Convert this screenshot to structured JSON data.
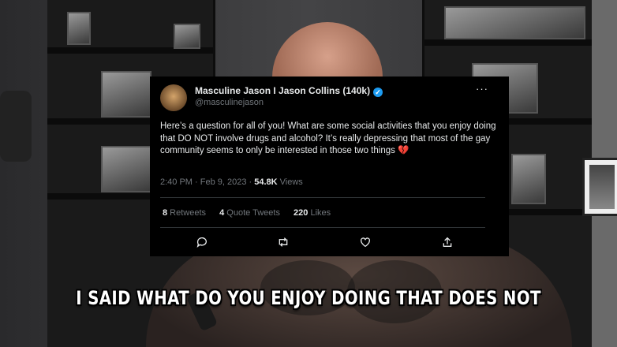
{
  "tweet": {
    "display_name": "Masculine Jason I Jason Collins (140k)",
    "handle": "@masculinejason",
    "text": "Here’s a question for all of you! What are some social activities that you enjoy doing that DO NOT involve drugs and alcohol? It’s really depressing that most of the gay community seems to only be interested in those two things",
    "emoji": "💔",
    "time_date": "2:40 PM · Feb 9, 2023 · ",
    "views_count": "54.8K",
    "views_label": " Views",
    "retweets_count": "8",
    "retweets_label": " Retweets",
    "quotes_count": "4",
    "quotes_label": " Quote Tweets",
    "likes_count": "220",
    "likes_label": " Likes",
    "more_label": "···"
  },
  "caption": "I SAID WHAT DO YOU ENJOY DOING THAT DOES NOT",
  "icons": [
    "verified-badge-icon",
    "more-options-icon",
    "reply-icon",
    "retweet-icon",
    "like-icon",
    "share-icon"
  ],
  "colors": {
    "tweet_bg": "#000000",
    "verified": "#1d9bf0",
    "muted": "#71767b"
  }
}
